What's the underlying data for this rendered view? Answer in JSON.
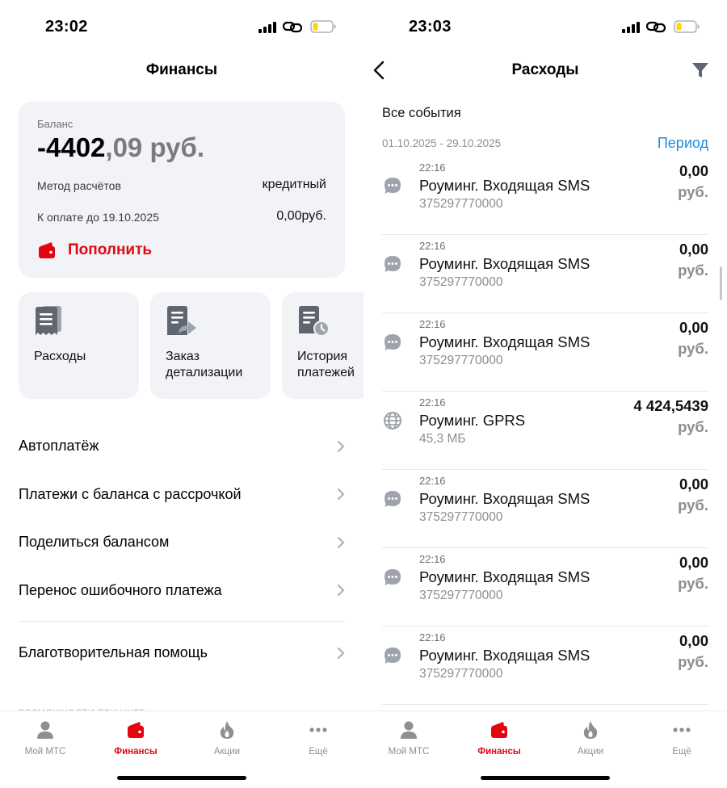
{
  "left": {
    "status": {
      "time": "23:02"
    },
    "header": {
      "title": "Финансы"
    },
    "balance": {
      "label": "Баланс",
      "amount_int": "-4402",
      "amount_frac": ",09 руб.",
      "method_label": "Метод расчётов",
      "method_value": "кредитный",
      "due_label": "К оплате до 19.10.2025",
      "due_value": "0,00руб.",
      "topup_label": "Пополнить"
    },
    "tiles": [
      {
        "label": "Расходы",
        "icon": "receipt-icon"
      },
      {
        "label": "Заказ детализации",
        "icon": "document-share-icon"
      },
      {
        "label": "История платежей",
        "icon": "document-clock-icon"
      }
    ],
    "menu": [
      "Автоплатёж",
      "Платежи с баланса с рассрочкой",
      "Поделиться балансом",
      "Перенос ошибочного платежа",
      "Благотворительная помощь"
    ],
    "faded_text": "ВОЗМОЖНОСТИ ПРИ НУЛЕ"
  },
  "right": {
    "status": {
      "time": "23:03"
    },
    "header": {
      "title": "Расходы"
    },
    "events_title": "Все события",
    "range": "01.10.2025 - 29.10.2025",
    "period_label": "Период",
    "transactions": [
      {
        "time": "22:16",
        "name": "Роуминг. Входящая SMS",
        "sub": "375297770000",
        "amount": "0,00",
        "currency": "руб.",
        "icon": "sms-icon"
      },
      {
        "time": "22:16",
        "name": "Роуминг. Входящая SMS",
        "sub": "375297770000",
        "amount": "0,00",
        "currency": "руб.",
        "icon": "sms-icon"
      },
      {
        "time": "22:16",
        "name": "Роуминг. Входящая SMS",
        "sub": "375297770000",
        "amount": "0,00",
        "currency": "руб.",
        "icon": "sms-icon"
      },
      {
        "time": "22:16",
        "name": "Роуминг. GPRS",
        "sub": "45,3 МБ",
        "amount": "4 424,5439",
        "currency": "руб.",
        "icon": "globe-icon"
      },
      {
        "time": "22:16",
        "name": "Роуминг. Входящая SMS",
        "sub": "375297770000",
        "amount": "0,00",
        "currency": "руб.",
        "icon": "sms-icon"
      },
      {
        "time": "22:16",
        "name": "Роуминг. Входящая SMS",
        "sub": "375297770000",
        "amount": "0,00",
        "currency": "руб.",
        "icon": "sms-icon"
      },
      {
        "time": "22:16",
        "name": "Роуминг. Входящая SMS",
        "sub": "375297770000",
        "amount": "0,00",
        "currency": "руб.",
        "icon": "sms-icon"
      }
    ]
  },
  "tabbar": [
    {
      "label": "Мой МТС",
      "icon": "person-icon",
      "active": false
    },
    {
      "label": "Финансы",
      "icon": "wallet-icon",
      "active": true
    },
    {
      "label": "Акции",
      "icon": "flame-icon",
      "active": false
    },
    {
      "label": "Ещё",
      "icon": "more-dots-icon",
      "active": false
    }
  ],
  "colors": {
    "brand_red": "#e30611",
    "link_blue": "#1a8fdf",
    "card_bg": "#f2f3f7",
    "muted_text": "#8e8e93"
  }
}
